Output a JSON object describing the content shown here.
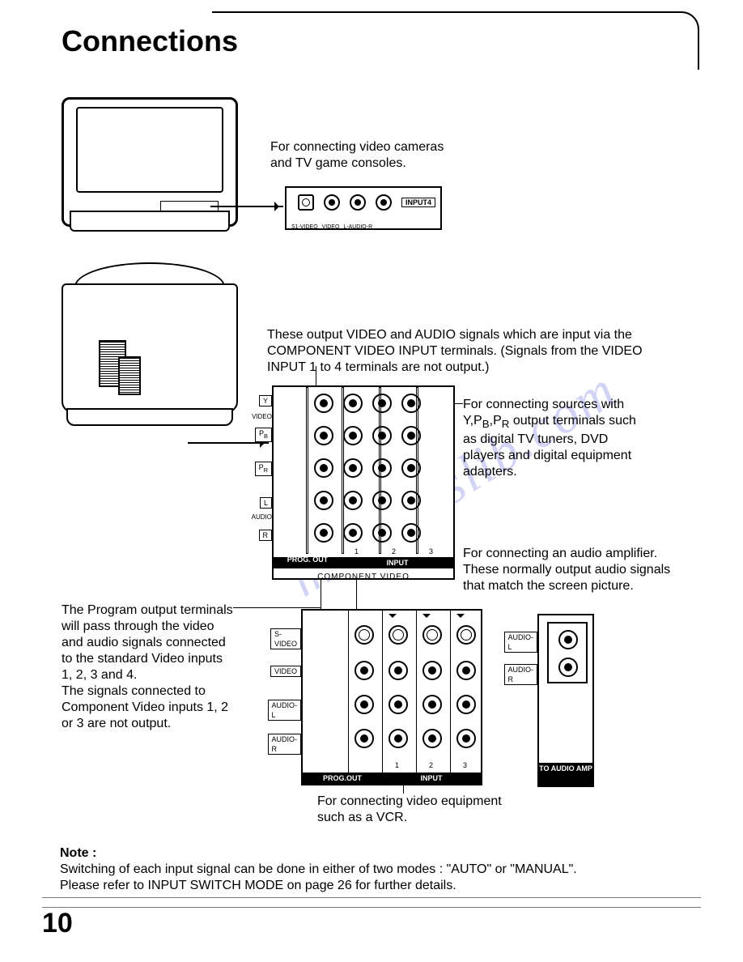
{
  "title": "Connections",
  "watermark": "manualslib.com",
  "page_number": "10",
  "captions": {
    "front_input": "For connecting video cameras and TV game consoles.",
    "component_out": "These output VIDEO and AUDIO signals which are input via the COMPONENT VIDEO INPUT terminals. (Signals from the VIDEO INPUT 1 to 4 terminals are not output.)",
    "component_in": "For connecting sources with Y,P",
    "component_in_sub": "B",
    "component_in_mid": ",P",
    "component_in_sub2": "R",
    "component_in_rest": " output terminals such as digital TV tuners, DVD players and digital equipment adapters.",
    "audio_amp": "For connecting an audio amplifier. These normally output audio signals that match the screen picture.",
    "prog_out": "The Program output terminals will pass through the video and audio signals connected to the standard Video inputs 1, 2, 3 and 4.\nThe signals connected to Component Video inputs 1, 2 or 3 are not output.",
    "std_input": "For connecting video equipment such as a VCR."
  },
  "front_panel": {
    "input_badge": "INPUT4",
    "labels": "S1-VIDEO VIDEO  L-AUDIO-R"
  },
  "component_block": {
    "row_labels": [
      "Y",
      "VIDEO",
      "P",
      "P",
      "L",
      "AUDIO",
      "R"
    ],
    "row_label_b": "B",
    "row_label_r": "R",
    "col_numbers": [
      "1",
      "2",
      "3"
    ],
    "bar_out": "PROG. OUT",
    "bar_in": "INPUT",
    "subtitle": "COMPONENT VIDEO"
  },
  "std_block": {
    "row_labels": [
      "S-VIDEO",
      "VIDEO",
      "AUDIO-L",
      "AUDIO-R"
    ],
    "col_numbers": [
      "1",
      "2",
      "3"
    ],
    "bar_out": "PROG.OUT",
    "bar_in": "INPUT"
  },
  "amp_block": {
    "labels": [
      "AUDIO-L",
      "AUDIO-R"
    ],
    "bar": "TO AUDIO AMP"
  },
  "note": {
    "heading": "Note :",
    "line1": "Switching of each input signal can be done in either of two modes : \"AUTO\" or \"MANUAL\".",
    "line2": "Please refer to INPUT SWITCH MODE on page 26 for further details."
  }
}
